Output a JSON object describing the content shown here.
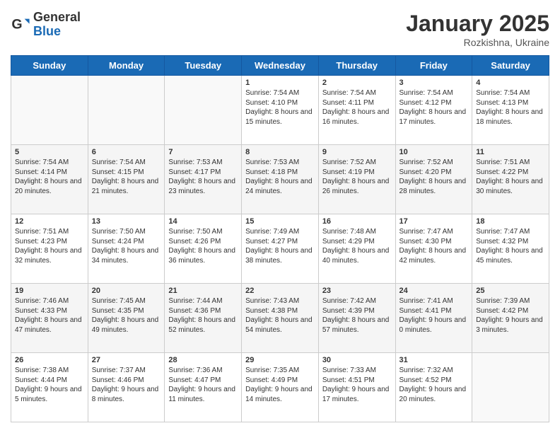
{
  "logo": {
    "general": "General",
    "blue": "Blue"
  },
  "header": {
    "month": "January 2025",
    "location": "Rozkishna, Ukraine"
  },
  "days_of_week": [
    "Sunday",
    "Monday",
    "Tuesday",
    "Wednesday",
    "Thursday",
    "Friday",
    "Saturday"
  ],
  "weeks": [
    [
      {
        "day": "",
        "info": ""
      },
      {
        "day": "",
        "info": ""
      },
      {
        "day": "",
        "info": ""
      },
      {
        "day": "1",
        "info": "Sunrise: 7:54 AM\nSunset: 4:10 PM\nDaylight: 8 hours\nand 15 minutes."
      },
      {
        "day": "2",
        "info": "Sunrise: 7:54 AM\nSunset: 4:11 PM\nDaylight: 8 hours\nand 16 minutes."
      },
      {
        "day": "3",
        "info": "Sunrise: 7:54 AM\nSunset: 4:12 PM\nDaylight: 8 hours\nand 17 minutes."
      },
      {
        "day": "4",
        "info": "Sunrise: 7:54 AM\nSunset: 4:13 PM\nDaylight: 8 hours\nand 18 minutes."
      }
    ],
    [
      {
        "day": "5",
        "info": "Sunrise: 7:54 AM\nSunset: 4:14 PM\nDaylight: 8 hours\nand 20 minutes."
      },
      {
        "day": "6",
        "info": "Sunrise: 7:54 AM\nSunset: 4:15 PM\nDaylight: 8 hours\nand 21 minutes."
      },
      {
        "day": "7",
        "info": "Sunrise: 7:53 AM\nSunset: 4:17 PM\nDaylight: 8 hours\nand 23 minutes."
      },
      {
        "day": "8",
        "info": "Sunrise: 7:53 AM\nSunset: 4:18 PM\nDaylight: 8 hours\nand 24 minutes."
      },
      {
        "day": "9",
        "info": "Sunrise: 7:52 AM\nSunset: 4:19 PM\nDaylight: 8 hours\nand 26 minutes."
      },
      {
        "day": "10",
        "info": "Sunrise: 7:52 AM\nSunset: 4:20 PM\nDaylight: 8 hours\nand 28 minutes."
      },
      {
        "day": "11",
        "info": "Sunrise: 7:51 AM\nSunset: 4:22 PM\nDaylight: 8 hours\nand 30 minutes."
      }
    ],
    [
      {
        "day": "12",
        "info": "Sunrise: 7:51 AM\nSunset: 4:23 PM\nDaylight: 8 hours\nand 32 minutes."
      },
      {
        "day": "13",
        "info": "Sunrise: 7:50 AM\nSunset: 4:24 PM\nDaylight: 8 hours\nand 34 minutes."
      },
      {
        "day": "14",
        "info": "Sunrise: 7:50 AM\nSunset: 4:26 PM\nDaylight: 8 hours\nand 36 minutes."
      },
      {
        "day": "15",
        "info": "Sunrise: 7:49 AM\nSunset: 4:27 PM\nDaylight: 8 hours\nand 38 minutes."
      },
      {
        "day": "16",
        "info": "Sunrise: 7:48 AM\nSunset: 4:29 PM\nDaylight: 8 hours\nand 40 minutes."
      },
      {
        "day": "17",
        "info": "Sunrise: 7:47 AM\nSunset: 4:30 PM\nDaylight: 8 hours\nand 42 minutes."
      },
      {
        "day": "18",
        "info": "Sunrise: 7:47 AM\nSunset: 4:32 PM\nDaylight: 8 hours\nand 45 minutes."
      }
    ],
    [
      {
        "day": "19",
        "info": "Sunrise: 7:46 AM\nSunset: 4:33 PM\nDaylight: 8 hours\nand 47 minutes."
      },
      {
        "day": "20",
        "info": "Sunrise: 7:45 AM\nSunset: 4:35 PM\nDaylight: 8 hours\nand 49 minutes."
      },
      {
        "day": "21",
        "info": "Sunrise: 7:44 AM\nSunset: 4:36 PM\nDaylight: 8 hours\nand 52 minutes."
      },
      {
        "day": "22",
        "info": "Sunrise: 7:43 AM\nSunset: 4:38 PM\nDaylight: 8 hours\nand 54 minutes."
      },
      {
        "day": "23",
        "info": "Sunrise: 7:42 AM\nSunset: 4:39 PM\nDaylight: 8 hours\nand 57 minutes."
      },
      {
        "day": "24",
        "info": "Sunrise: 7:41 AM\nSunset: 4:41 PM\nDaylight: 9 hours\nand 0 minutes."
      },
      {
        "day": "25",
        "info": "Sunrise: 7:39 AM\nSunset: 4:42 PM\nDaylight: 9 hours\nand 3 minutes."
      }
    ],
    [
      {
        "day": "26",
        "info": "Sunrise: 7:38 AM\nSunset: 4:44 PM\nDaylight: 9 hours\nand 5 minutes."
      },
      {
        "day": "27",
        "info": "Sunrise: 7:37 AM\nSunset: 4:46 PM\nDaylight: 9 hours\nand 8 minutes."
      },
      {
        "day": "28",
        "info": "Sunrise: 7:36 AM\nSunset: 4:47 PM\nDaylight: 9 hours\nand 11 minutes."
      },
      {
        "day": "29",
        "info": "Sunrise: 7:35 AM\nSunset: 4:49 PM\nDaylight: 9 hours\nand 14 minutes."
      },
      {
        "day": "30",
        "info": "Sunrise: 7:33 AM\nSunset: 4:51 PM\nDaylight: 9 hours\nand 17 minutes."
      },
      {
        "day": "31",
        "info": "Sunrise: 7:32 AM\nSunset: 4:52 PM\nDaylight: 9 hours\nand 20 minutes."
      },
      {
        "day": "",
        "info": ""
      }
    ]
  ]
}
